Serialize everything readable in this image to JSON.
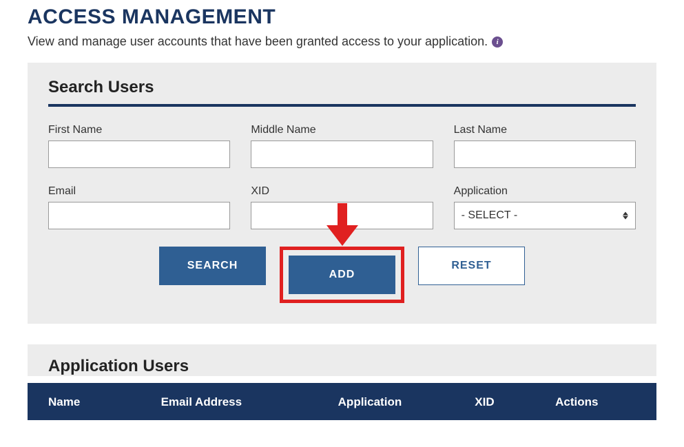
{
  "page": {
    "title": "ACCESS MANAGEMENT",
    "subtitle": "View and manage user accounts that have been granted access to your application."
  },
  "searchPanel": {
    "title": "Search Users",
    "fields": {
      "firstNameLabel": "First Name",
      "firstNameValue": "",
      "middleNameLabel": "Middle Name",
      "middleNameValue": "",
      "lastNameLabel": "Last Name",
      "lastNameValue": "",
      "emailLabel": "Email",
      "emailValue": "",
      "xidLabel": "XID",
      "xidValue": "",
      "applicationLabel": "Application",
      "applicationValue": "- SELECT -"
    },
    "buttons": {
      "search": "SEARCH",
      "add": "ADD",
      "reset": "RESET"
    }
  },
  "usersPanel": {
    "title": "Application Users",
    "columns": {
      "name": "Name",
      "email": "Email Address",
      "application": "Application",
      "xid": "XID",
      "actions": "Actions"
    }
  },
  "annotation": {
    "highlightColor": "#e02020"
  }
}
